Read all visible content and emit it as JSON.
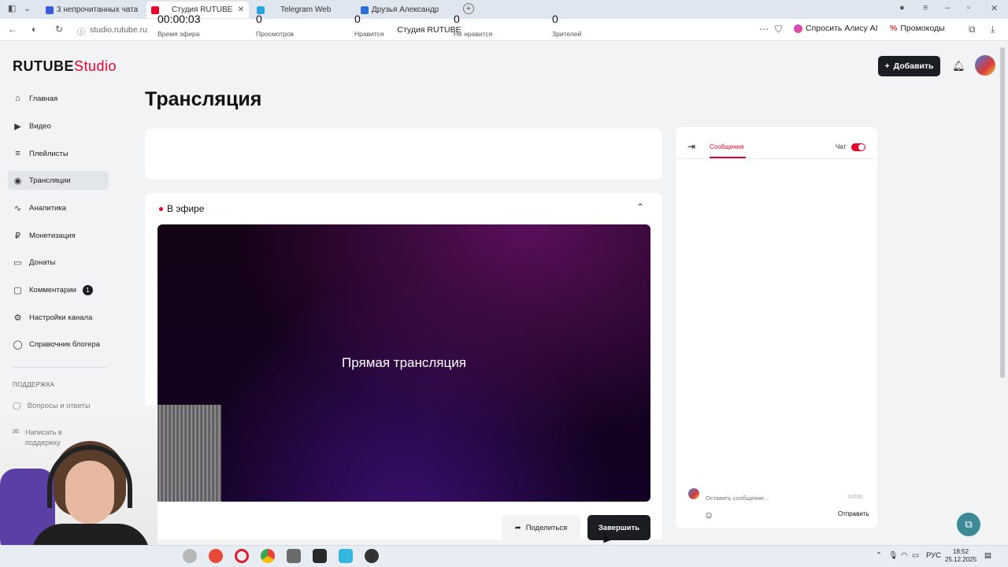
{
  "browser": {
    "tabs": [
      {
        "label": "3 непрочитанных чата",
        "color": "#3a5bd9",
        "active": false
      },
      {
        "label": "Студия RUTUBE",
        "color": "#e8002d",
        "active": true
      },
      {
        "label": "Telegram Web",
        "color": "#2aa3df",
        "active": false
      },
      {
        "label": "Друзья Александр",
        "color": "#2a6fd9",
        "active": false
      }
    ],
    "url": "studio.rutube.ru",
    "page_title": "Студия RUTUBE",
    "alice_label": "Спросить Алису AI",
    "promo_label": "Промокоды"
  },
  "header": {
    "logo_main": "RUTUBE",
    "logo_studio": "Studio",
    "add_label": "Добавить"
  },
  "sidebar": {
    "items": [
      {
        "label": "Главная",
        "icon": "home-icon",
        "glyph": "⌂"
      },
      {
        "label": "Видео",
        "icon": "video-icon",
        "glyph": "▶"
      },
      {
        "label": "Плейлисты",
        "icon": "playlist-icon",
        "glyph": "≡"
      },
      {
        "label": "Трансляции",
        "icon": "broadcast-icon",
        "glyph": "◉"
      },
      {
        "label": "Аналитика",
        "icon": "analytics-icon",
        "glyph": "∿"
      },
      {
        "label": "Монетизация",
        "icon": "monetization-icon",
        "glyph": "₽"
      },
      {
        "label": "Донаты",
        "icon": "donate-icon",
        "glyph": "▭"
      },
      {
        "label": "Комментарии",
        "icon": "comments-icon",
        "glyph": "▢",
        "badge": "1"
      },
      {
        "label": "Настройки канала",
        "icon": "settings-icon",
        "glyph": "⚙"
      },
      {
        "label": "Справочник блогера",
        "icon": "help-book-icon",
        "glyph": "◯"
      }
    ],
    "support_section": "ПОДДЕРЖКА",
    "support_items": [
      {
        "label": "Вопросы и ответы"
      },
      {
        "label": "Написать в поддержку"
      }
    ]
  },
  "main": {
    "title": "Трансляция",
    "stats": [
      {
        "value": "00:00:03",
        "label": "Время эфира"
      },
      {
        "value": "0",
        "label": "Просмотров"
      },
      {
        "value": "0",
        "label": "Нравится"
      },
      {
        "value": "0",
        "label": "Не нравится"
      },
      {
        "value": "0",
        "label": "Зрителей"
      }
    ],
    "live_label": "В эфире",
    "player_text": "Прямая трансляция",
    "share_label": "Поделиться",
    "end_label": "Завершить"
  },
  "chat": {
    "tab_label": "Сообщения",
    "toggle_label": "Чат",
    "input_placeholder": "Оставить сообщение...",
    "counter": "0/200",
    "send_label": "Отправить"
  },
  "taskbar": {
    "lang": "РУС",
    "time": "18:52",
    "date": "25.12.2025"
  },
  "colors": {
    "accent": "#e8002d",
    "dark_button": "#1a1d21"
  }
}
